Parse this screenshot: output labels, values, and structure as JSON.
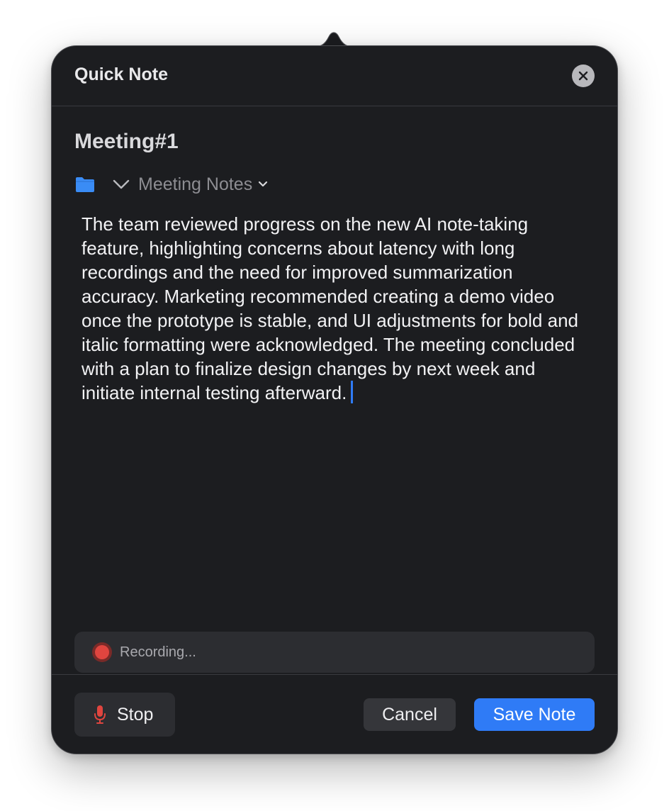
{
  "window": {
    "title": "Quick Note",
    "close_icon": "close-icon"
  },
  "note": {
    "title": "Meeting#1",
    "folder": {
      "icon": "folder-icon",
      "selected": "Meeting Notes"
    },
    "body": "The team reviewed progress on the new AI note-taking feature, highlighting concerns about latency with long recordings and the need for improved summarization accuracy. Marketing recommended creating a demo video once the prototype is stable, and UI adjustments for bold and italic formatting were acknowledged. The meeting concluded with a plan to finalize design changes by next week and initiate internal testing afterward."
  },
  "recording": {
    "status": "Recording...",
    "icon": "record-dot-icon"
  },
  "footer": {
    "stop_label": "Stop",
    "stop_icon": "microphone-icon",
    "cancel_label": "Cancel",
    "save_label": "Save Note"
  },
  "colors": {
    "accent": "#2f7bf6",
    "background": "#1c1d20",
    "record": "#e0453f",
    "folder": "#3a8cf5"
  }
}
